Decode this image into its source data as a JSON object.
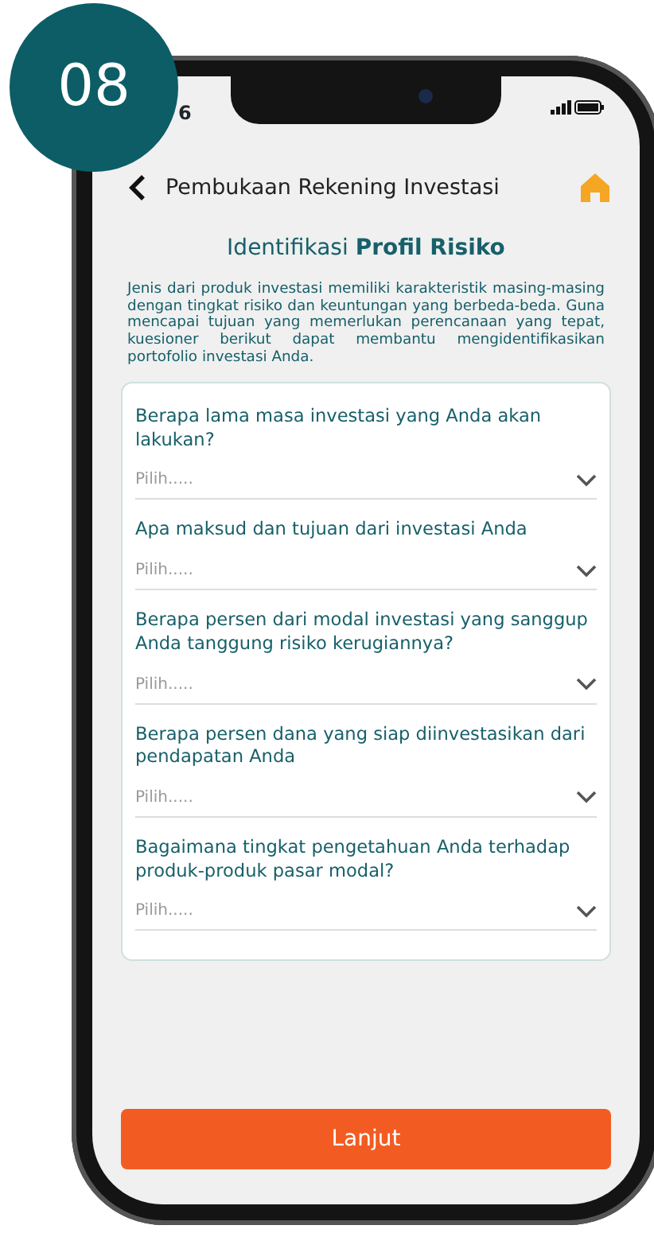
{
  "step_badge": "08",
  "status_bar": {
    "time": "6"
  },
  "header": {
    "title": "Pembukaan Rekening Investasi"
  },
  "section_title": "Identifikasi **Profil Risiko**",
  "intro": "Jenis dari produk investasi memiliki karakteristik masing-masing dengan tingkat risiko dan keuntungan yang berbeda-beda. Guna mencapai tujuan yang memerlukan perencanaan yang tepat, kuesioner berikut dapat membantu mengidentifikasikan portofolio investasi Anda.",
  "questions": [
    {
      "label": "Berapa lama masa investasi yang Anda akan lakukan?",
      "placeholder": "Pilih....."
    },
    {
      "label": "Apa maksud dan tujuan dari investasi Anda",
      "placeholder": "Pilih....."
    },
    {
      "label": "Berapa persen dari modal investasi yang sanggup Anda tanggung risiko kerugiannya?",
      "placeholder": "Pilih....."
    },
    {
      "label": "Berapa persen dana yang siap diinvestasikan dari pendapatan Anda",
      "placeholder": "Pilih....."
    },
    {
      "label": "Bagaimana tingkat pengetahuan Anda terhadap produk-produk pasar modal?",
      "placeholder": "Pilih....."
    }
  ],
  "submit": "Lanjut"
}
